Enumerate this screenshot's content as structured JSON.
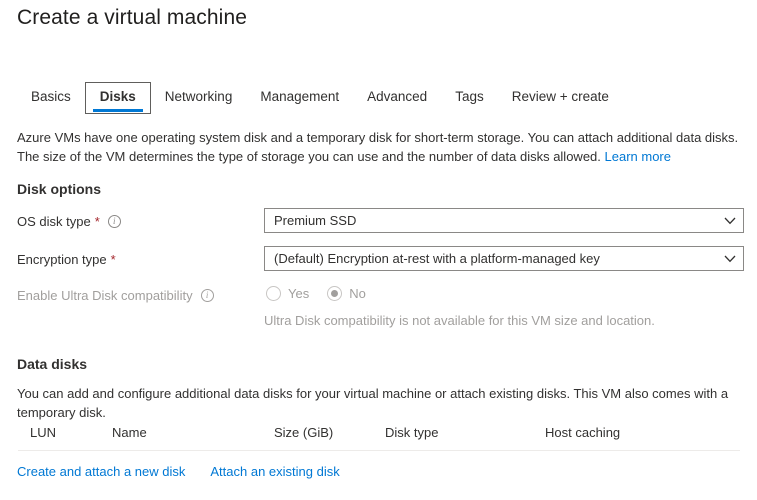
{
  "page": {
    "title": "Create a virtual machine"
  },
  "tabs": [
    {
      "label": "Basics",
      "selected": false
    },
    {
      "label": "Disks",
      "selected": true
    },
    {
      "label": "Networking",
      "selected": false
    },
    {
      "label": "Management",
      "selected": false
    },
    {
      "label": "Advanced",
      "selected": false
    },
    {
      "label": "Tags",
      "selected": false
    },
    {
      "label": "Review + create",
      "selected": false
    }
  ],
  "intro": {
    "text": "Azure VMs have one operating system disk and a temporary disk for short-term storage. You can attach additional data disks. The size of the VM determines the type of storage you can use and the number of data disks allowed. ",
    "link_label": "Learn more"
  },
  "disk_options": {
    "heading": "Disk options",
    "os_disk_type": {
      "label": "OS disk type",
      "required_mark": "*",
      "info_icon": "info-icon",
      "value": "Premium SSD"
    },
    "encryption_type": {
      "label": "Encryption type",
      "required_mark": "*",
      "value": "(Default) Encryption at-rest with a platform-managed key"
    },
    "ultra_disk": {
      "label": "Enable Ultra Disk compatibility",
      "info_icon": "info-icon",
      "options": [
        {
          "label": "Yes",
          "checked": false
        },
        {
          "label": "No",
          "checked": true
        }
      ],
      "helper_text": "Ultra Disk compatibility is not available for this VM size and location.",
      "disabled": true
    }
  },
  "data_disks": {
    "heading": "Data disks",
    "description": "You can add and configure additional data disks for your virtual machine or attach existing disks. This VM also comes with a temporary disk.",
    "table": {
      "columns": [
        "LUN",
        "Name",
        "Size (GiB)",
        "Disk type",
        "Host caching"
      ],
      "rows": []
    },
    "actions": [
      {
        "label": "Create and attach a new disk"
      },
      {
        "label": "Attach an existing disk"
      }
    ]
  },
  "colors": {
    "accent": "#0078d4",
    "required": "#a4262c",
    "text": "#323130",
    "disabled_text": "#a19f9d",
    "border": "#8a8886",
    "divider": "#edebe9"
  }
}
